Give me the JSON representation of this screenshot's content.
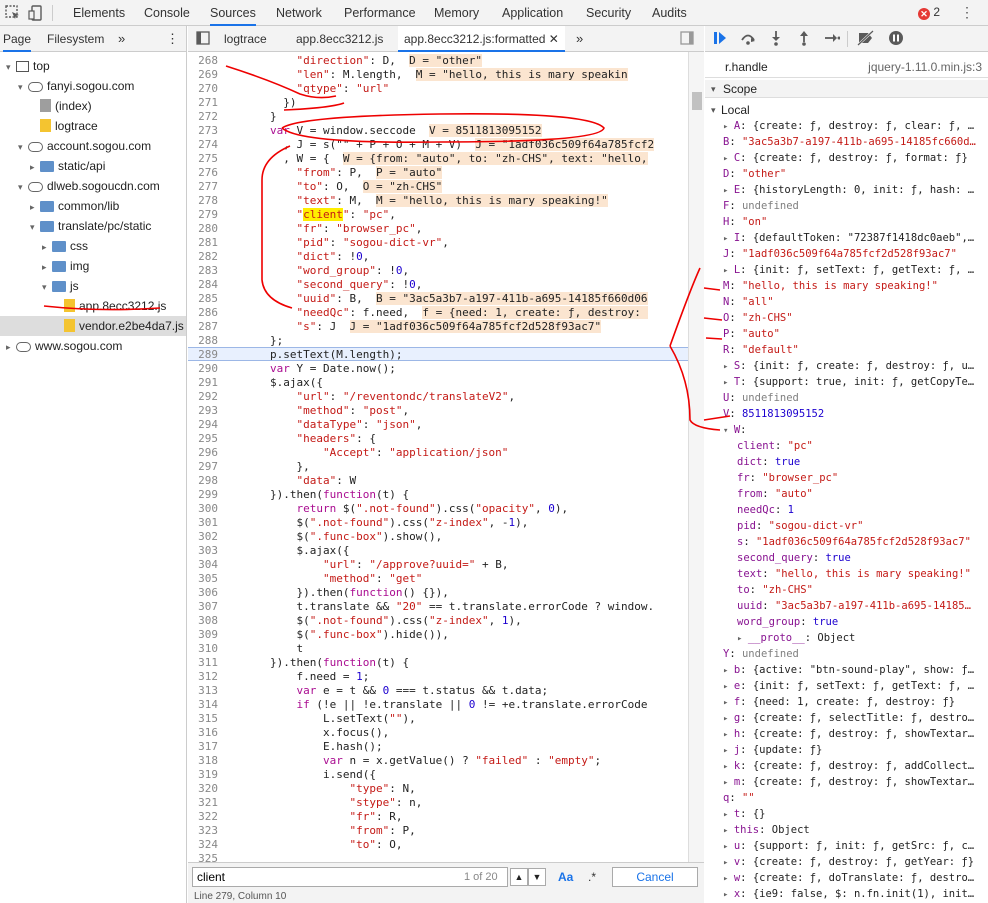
{
  "topbar": {
    "tabs": [
      "Elements",
      "Console",
      "Sources",
      "Network",
      "Performance",
      "Memory",
      "Application",
      "Security",
      "Audits"
    ],
    "active_tab": "Sources",
    "error_count": "2"
  },
  "navigator": {
    "tabs": [
      "Page",
      "Filesystem"
    ],
    "tree": [
      {
        "label": "top",
        "icon": "frame-icon",
        "depth": 0,
        "expanded": true
      },
      {
        "label": "fanyi.sogou.com",
        "icon": "cloud-icon",
        "depth": 1,
        "expanded": true
      },
      {
        "label": "(index)",
        "icon": "file-gray",
        "depth": 2
      },
      {
        "label": "logtrace",
        "icon": "file-yellow",
        "depth": 2
      },
      {
        "label": "account.sogou.com",
        "icon": "cloud-icon",
        "depth": 1,
        "expanded": true
      },
      {
        "label": "static/api",
        "icon": "folder-icon",
        "depth": 2,
        "expanded": false
      },
      {
        "label": "dlweb.sogoucdn.com",
        "icon": "cloud-icon",
        "depth": 1,
        "expanded": true
      },
      {
        "label": "common/lib",
        "icon": "folder-icon",
        "depth": 2,
        "expanded": false
      },
      {
        "label": "translate/pc/static",
        "icon": "folder-icon",
        "depth": 2,
        "expanded": true
      },
      {
        "label": "css",
        "icon": "folder-icon",
        "depth": 3,
        "expanded": false
      },
      {
        "label": "img",
        "icon": "folder-icon",
        "depth": 3,
        "expanded": false
      },
      {
        "label": "js",
        "icon": "folder-icon",
        "depth": 3,
        "expanded": true
      },
      {
        "label": "app.8ecc3212.js",
        "icon": "file-yellow",
        "depth": 4,
        "selected": true
      },
      {
        "label": "vendor.e2be4da7.js",
        "icon": "file-yellow",
        "depth": 4
      },
      {
        "label": "www.sogou.com",
        "icon": "cloud-icon",
        "depth": 0,
        "expanded": false
      }
    ]
  },
  "editor": {
    "tabs": [
      "logtrace",
      "app.8ecc3212.js",
      "app.8ecc3212.js:formatted"
    ],
    "active_tab": "app.8ecc3212.js:formatted",
    "lines": [
      {
        "n": "268",
        "html": "    <span class='s'>\"direction\"</span>: D,  <span class='inl'>D = \"other\"</span>"
      },
      {
        "n": "269",
        "html": "    <span class='s'>\"len\"</span>: M.length,  <span class='inl'>M = \"hello, this is mary speakin</span>"
      },
      {
        "n": "270",
        "html": "    <span class='s'>\"qtype\"</span>: <span class='s'>\"url\"</span>"
      },
      {
        "n": "271",
        "html": "  })"
      },
      {
        "n": "272",
        "html": "}"
      },
      {
        "n": "273",
        "html": "<span class='k'>var</span> V = window.seccode  <span class='inl'>V = 8511813095152</span>"
      },
      {
        "n": "274",
        "html": "  , J = s(\"\" + P + O + M + V)  <span class='inl'>J = \"1adf036c509f64a785fcf2</span>"
      },
      {
        "n": "275",
        "html": "  , W = {  <span class='inl'>W = {from: \"auto\", to: \"zh-CHS\", text: \"hello,</span>"
      },
      {
        "n": "276",
        "html": "    <span class='s'>\"from\"</span>: P,  <span class='inl'>P = \"auto\"</span>"
      },
      {
        "n": "277",
        "html": "    <span class='s'>\"to\"</span>: O,  <span class='inl'>O = \"zh-CHS\"</span>"
      },
      {
        "n": "278",
        "html": "    <span class='s'>\"text\"</span>: M,  <span class='inl'>M = \"hello, this is mary speaking!\"</span>"
      },
      {
        "n": "279",
        "html": "    <span class='s'>\"<span class='match'>client</span>\"</span>: <span class='s'>\"pc\"</span>,"
      },
      {
        "n": "280",
        "html": "    <span class='s'>\"fr\"</span>: <span class='s'>\"browser_pc\"</span>,"
      },
      {
        "n": "281",
        "html": "    <span class='s'>\"pid\"</span>: <span class='s'>\"sogou-dict-vr\"</span>,"
      },
      {
        "n": "282",
        "html": "    <span class='s'>\"dict\"</span>: !<span class='n'>0</span>,"
      },
      {
        "n": "283",
        "html": "    <span class='s'>\"word_group\"</span>: !<span class='n'>0</span>,"
      },
      {
        "n": "284",
        "html": "    <span class='s'>\"second_query\"</span>: !<span class='n'>0</span>,"
      },
      {
        "n": "285",
        "html": "    <span class='s'>\"uuid\"</span>: B,  <span class='inl'>B = \"3ac5a3b7-a197-411b-a695-14185f660d06</span>"
      },
      {
        "n": "286",
        "html": "    <span class='s'>\"needQc\"</span>: f.need,  <span class='inl'>f = {need: 1, create: ƒ, destroy: </span>"
      },
      {
        "n": "287",
        "html": "    <span class='s'>\"s\"</span>: J  <span class='inl'>J = \"1adf036c509f64a785fcf2d528f93ac7\"</span>"
      },
      {
        "n": "288",
        "html": "};"
      },
      {
        "n": "289",
        "html": "p.setText(M.length);"
      },
      {
        "n": "290",
        "html": "<span class='k'>var</span> Y = Date.now();"
      },
      {
        "n": "291",
        "html": "$.ajax({"
      },
      {
        "n": "292",
        "html": "    <span class='s'>\"url\"</span>: <span class='s'>\"/reventondc/translateV2\"</span>,"
      },
      {
        "n": "293",
        "html": "    <span class='s'>\"method\"</span>: <span class='s'>\"post\"</span>,"
      },
      {
        "n": "294",
        "html": "    <span class='s'>\"dataType\"</span>: <span class='s'>\"json\"</span>,"
      },
      {
        "n": "295",
        "html": "    <span class='s'>\"headers\"</span>: {"
      },
      {
        "n": "296",
        "html": "        <span class='s'>\"Accept\"</span>: <span class='s'>\"application/json\"</span>"
      },
      {
        "n": "297",
        "html": "    },"
      },
      {
        "n": "298",
        "html": "    <span class='s'>\"data\"</span>: W"
      },
      {
        "n": "299",
        "html": "}).then(<span class='k'>function</span>(t) {"
      },
      {
        "n": "300",
        "html": "    <span class='k'>return</span> $(<span class='s'>\".not-found\"</span>).css(<span class='s'>\"opacity\"</span>, <span class='n'>0</span>),"
      },
      {
        "n": "301",
        "html": "    $(<span class='s'>\".not-found\"</span>).css(<span class='s'>\"z-index\"</span>, -<span class='n'>1</span>),"
      },
      {
        "n": "302",
        "html": "    $(<span class='s'>\".func-box\"</span>).show(),"
      },
      {
        "n": "303",
        "html": "    $.ajax({"
      },
      {
        "n": "304",
        "html": "        <span class='s'>\"url\"</span>: <span class='s'>\"/approve?uuid=\"</span> + B,"
      },
      {
        "n": "305",
        "html": "        <span class='s'>\"method\"</span>: <span class='s'>\"get\"</span>"
      },
      {
        "n": "306",
        "html": "    }).then(<span class='k'>function</span>() {}),"
      },
      {
        "n": "307",
        "html": "    t.translate &amp;&amp; <span class='s'>\"20\"</span> == t.translate.errorCode ? window."
      },
      {
        "n": "308",
        "html": "    $(<span class='s'>\".not-found\"</span>).css(<span class='s'>\"z-index\"</span>, <span class='n'>1</span>),"
      },
      {
        "n": "309",
        "html": "    $(<span class='s'>\".func-box\"</span>).hide()),"
      },
      {
        "n": "310",
        "html": "    t"
      },
      {
        "n": "311",
        "html": "}).then(<span class='k'>function</span>(t) {"
      },
      {
        "n": "312",
        "html": "    f.need = <span class='n'>1</span>;"
      },
      {
        "n": "313",
        "html": "    <span class='k'>var</span> e = t &amp;&amp; <span class='n'>0</span> === t.status &amp;&amp; t.data;"
      },
      {
        "n": "314",
        "html": "    <span class='k'>if</span> (!e || !e.translate || <span class='n'>0</span> != +e.translate.errorCode"
      },
      {
        "n": "315",
        "html": "        L.setText(<span class='s'>\"\"</span>),"
      },
      {
        "n": "316",
        "html": "        x.focus(),"
      },
      {
        "n": "317",
        "html": "        E.hash();"
      },
      {
        "n": "318",
        "html": "        <span class='k'>var</span> n = x.getValue() ? <span class='s'>\"failed\"</span> : <span class='s'>\"empty\"</span>;"
      },
      {
        "n": "319",
        "html": "        i.send({"
      },
      {
        "n": "320",
        "html": "            <span class='s'>\"type\"</span>: N,"
      },
      {
        "n": "321",
        "html": "            <span class='s'>\"stype\"</span>: n,"
      },
      {
        "n": "322",
        "html": "            <span class='s'>\"fr\"</span>: R,"
      },
      {
        "n": "323",
        "html": "            <span class='s'>\"from\"</span>: P,"
      },
      {
        "n": "324",
        "html": "            <span class='s'>\"to\"</span>: O,"
      },
      {
        "n": "325",
        "html": ""
      }
    ],
    "search": {
      "value": "client",
      "count": "1 of 20",
      "case_label": "Aa",
      "regex_label": ".*",
      "cancel_label": "Cancel"
    },
    "status": "Line 279, Column 10"
  },
  "debugger": {
    "callstack_item": "r.handle",
    "callstack_source": "jquery-1.11.0.min.js:3",
    "scope_label": "Scope",
    "local_label": "Local",
    "scope_rows": [
      {
        "t": "▸",
        "k": "A",
        "v": "{create: ƒ, destroy: ƒ, clear: ƒ, …",
        "c": "o"
      },
      {
        "t": "",
        "k": "B",
        "v": "\"3ac5a3b7-a197-411b-a695-14185fc660d…",
        "c": "s"
      },
      {
        "t": "▸",
        "k": "C",
        "v": "{create: ƒ, destroy: ƒ, format: ƒ}",
        "c": "o"
      },
      {
        "t": "",
        "k": "D",
        "v": "\"other\"",
        "c": "s"
      },
      {
        "t": "▸",
        "k": "E",
        "v": "{historyLength: 0, init: ƒ, hash: …",
        "c": "o"
      },
      {
        "t": "",
        "k": "F",
        "v": "undefined",
        "c": "u"
      },
      {
        "t": "",
        "k": "H",
        "v": "\"on\"",
        "c": "s"
      },
      {
        "t": "▸",
        "k": "I",
        "v": "{defaultToken: \"72387f1418dc0aeb\",…",
        "c": "o"
      },
      {
        "t": "",
        "k": "J",
        "v": "\"1adf036c509f64a785fcf2d528f93ac7\"",
        "c": "s"
      },
      {
        "t": "▸",
        "k": "L",
        "v": "{init: ƒ, setText: ƒ, getText: ƒ, …",
        "c": "o"
      },
      {
        "t": "",
        "k": "M",
        "v": "\"hello, this is mary speaking!\"",
        "c": "s"
      },
      {
        "t": "",
        "k": "N",
        "v": "\"all\"",
        "c": "s"
      },
      {
        "t": "",
        "k": "O",
        "v": "\"zh-CHS\"",
        "c": "s"
      },
      {
        "t": "",
        "k": "P",
        "v": "\"auto\"",
        "c": "s"
      },
      {
        "t": "",
        "k": "R",
        "v": "\"default\"",
        "c": "s"
      },
      {
        "t": "▸",
        "k": "S",
        "v": "{init: ƒ, create: ƒ, destroy: ƒ, u…",
        "c": "o"
      },
      {
        "t": "▸",
        "k": "T",
        "v": "{support: true, init: ƒ, getCopyTe…",
        "c": "o"
      },
      {
        "t": "",
        "k": "U",
        "v": "undefined",
        "c": "u"
      },
      {
        "t": "",
        "k": "V",
        "v": "8511813095152",
        "c": "n"
      },
      {
        "t": "▾",
        "k": "W",
        "v": "",
        "c": "o"
      },
      {
        "t": "  ",
        "k": "client",
        "v": "\"pc\"",
        "c": "s"
      },
      {
        "t": "  ",
        "k": "dict",
        "v": "true",
        "c": "n"
      },
      {
        "t": "  ",
        "k": "fr",
        "v": "\"browser_pc\"",
        "c": "s"
      },
      {
        "t": "  ",
        "k": "from",
        "v": "\"auto\"",
        "c": "s"
      },
      {
        "t": "  ",
        "k": "needQc",
        "v": "1",
        "c": "n"
      },
      {
        "t": "  ",
        "k": "pid",
        "v": "\"sogou-dict-vr\"",
        "c": "s"
      },
      {
        "t": "  ",
        "k": "s",
        "v": "\"1adf036c509f64a785fcf2d528f93ac7\"",
        "c": "s"
      },
      {
        "t": "  ",
        "k": "second_query",
        "v": "true",
        "c": "n"
      },
      {
        "t": "  ",
        "k": "text",
        "v": "\"hello, this is mary speaking!\"",
        "c": "s"
      },
      {
        "t": "  ",
        "k": "to",
        "v": "\"zh-CHS\"",
        "c": "s"
      },
      {
        "t": "  ",
        "k": "uuid",
        "v": "\"3ac5a3b7-a197-411b-a695-14185…",
        "c": "s"
      },
      {
        "t": "  ",
        "k": "word_group",
        "v": "true",
        "c": "n"
      },
      {
        "t": "  ▸",
        "k": "__proto__",
        "v": "Object",
        "c": "o"
      },
      {
        "t": "",
        "k": "Y",
        "v": "undefined",
        "c": "u"
      },
      {
        "t": "▸",
        "k": "b",
        "v": "{active: \"btn-sound-play\", show: ƒ…",
        "c": "o"
      },
      {
        "t": "▸",
        "k": "e",
        "v": "{init: ƒ, setText: ƒ, getText: ƒ, …",
        "c": "o"
      },
      {
        "t": "▸",
        "k": "f",
        "v": "{need: 1, create: ƒ, destroy: ƒ}",
        "c": "o"
      },
      {
        "t": "▸",
        "k": "g",
        "v": "{create: ƒ, selectTitle: ƒ, destro…",
        "c": "o"
      },
      {
        "t": "▸",
        "k": "h",
        "v": "{create: ƒ, destroy: ƒ, showTextar…",
        "c": "o"
      },
      {
        "t": "▸",
        "k": "j",
        "v": "{update: ƒ}",
        "c": "o"
      },
      {
        "t": "▸",
        "k": "k",
        "v": "{create: ƒ, destroy: ƒ, addCollect…",
        "c": "o"
      },
      {
        "t": "▸",
        "k": "m",
        "v": "{create: ƒ, destroy: ƒ, showTextar…",
        "c": "o"
      },
      {
        "t": "",
        "k": "q",
        "v": "\"\"",
        "c": "s"
      },
      {
        "t": "▸",
        "k": "t",
        "v": "{}",
        "c": "o"
      },
      {
        "t": "▸",
        "k": "this",
        "v": "Object",
        "c": "o"
      },
      {
        "t": "▸",
        "k": "u",
        "v": "{support: ƒ, init: ƒ, getSrc: ƒ, c…",
        "c": "o"
      },
      {
        "t": "▸",
        "k": "v",
        "v": "{create: ƒ, destroy: ƒ, getYear: ƒ}",
        "c": "o"
      },
      {
        "t": "▸",
        "k": "w",
        "v": "{create: ƒ, doTranslate: ƒ, destro…",
        "c": "o"
      },
      {
        "t": "▸",
        "k": "x",
        "v": "{ie9: false, $: n.fn.init(1), init…",
        "c": "o"
      }
    ]
  }
}
